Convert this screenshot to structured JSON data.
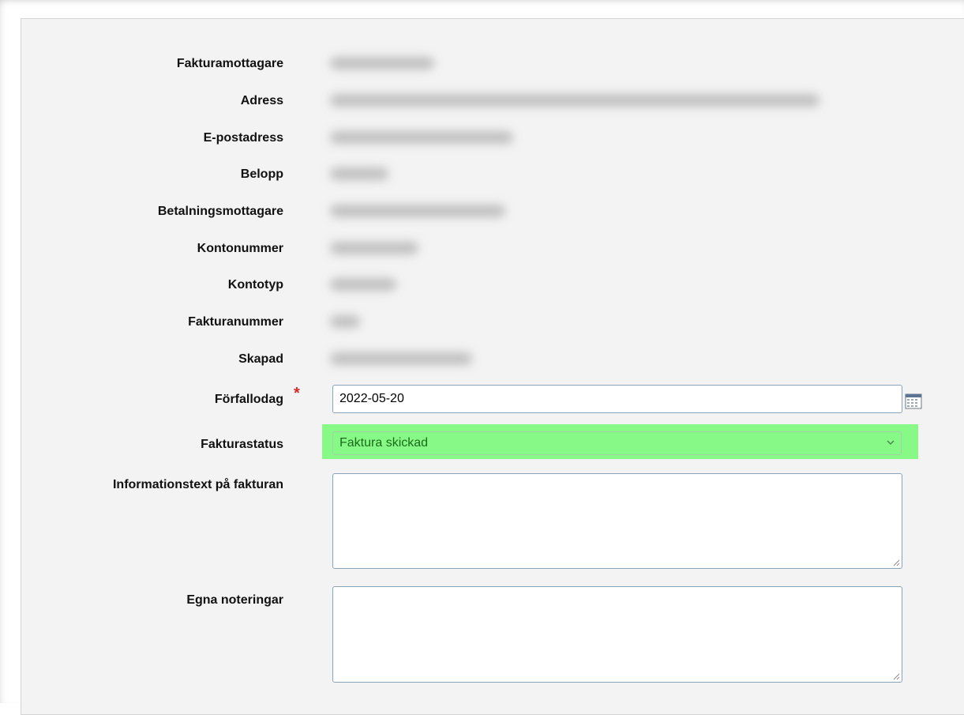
{
  "form": {
    "labels": {
      "fakturamottagare": "Fakturamottagare",
      "adress": "Adress",
      "epostadress": "E-postadress",
      "belopp": "Belopp",
      "betalningsmottagare": "Betalningsmottagare",
      "kontonummer": "Kontonummer",
      "kontotyp": "Kontotyp",
      "fakturanummer": "Fakturanummer",
      "skapad": "Skapad",
      "forfallodag": "Förfallodag",
      "fakturastatus": "Fakturastatus",
      "informationstext": "Informationstext på fakturan",
      "egna_noteringar": "Egna noteringar"
    },
    "required_marker": "*",
    "due_date_value": "2022-05-20",
    "status_selected": "Faktura skickad",
    "information_text_value": "",
    "own_notes_value": ""
  },
  "icons": {
    "calendar": "calendar-icon",
    "select_chevron": "chevron-down-icon"
  },
  "colors": {
    "status_highlight": "#86f986",
    "status_text": "#1b6b1b",
    "required_star": "#d42a2a",
    "panel_background": "#f3f3f3"
  }
}
